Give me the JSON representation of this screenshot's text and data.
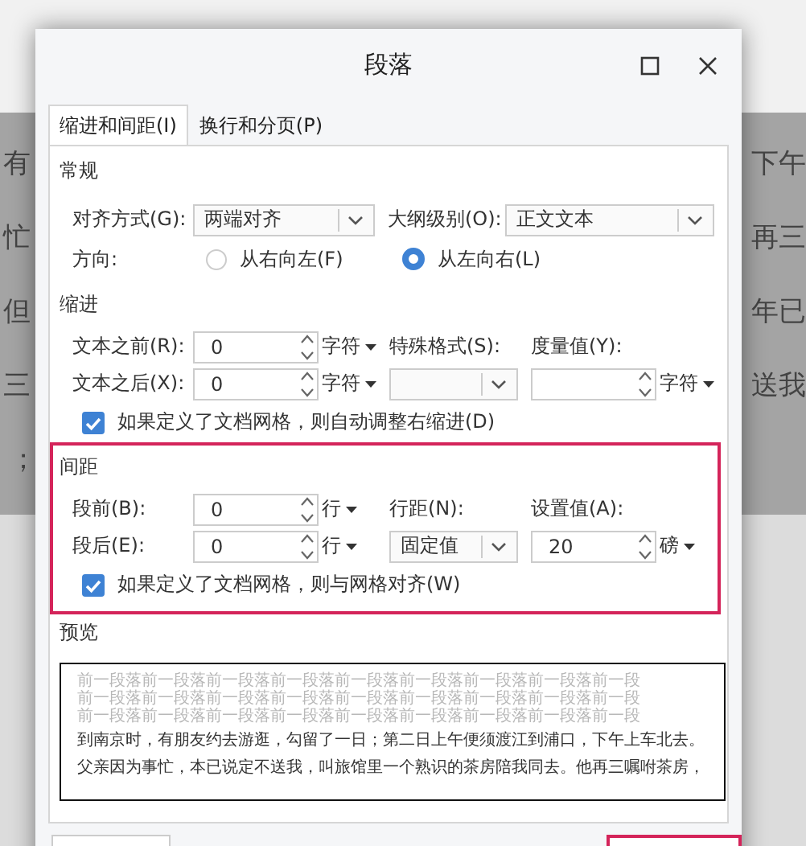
{
  "background_document": {
    "lines": [
      {
        "left": "有",
        "right": "下午"
      },
      {
        "left": "忙",
        "right": "再三"
      },
      {
        "left": "但",
        "right": "年已"
      },
      {
        "left": "三",
        "right": "送我"
      },
      {
        "left": "；"
      }
    ]
  },
  "window": {
    "title": "段落"
  },
  "tabs": [
    {
      "label": "缩进和间距(I)",
      "selected": true
    },
    {
      "label": "换行和分页(P)",
      "selected": false
    }
  ],
  "sections": [
    {
      "heading": "常规",
      "highlighted": false,
      "rows": [
        [
          {
            "kind": "label",
            "text": "对齐方式(G):"
          },
          {
            "kind": "select",
            "value": "两端对齐"
          },
          {
            "kind": "label",
            "text": "大纲级别(O):"
          },
          {
            "kind": "select",
            "value": "正文文本"
          }
        ],
        [
          {
            "kind": "label",
            "text": "方向:"
          },
          {
            "kind": "radio",
            "label": "从右向左(F)",
            "selected": false
          },
          {
            "kind": "radio",
            "label": "从左向右(L)",
            "selected": true
          }
        ]
      ]
    },
    {
      "heading": "缩进",
      "highlighted": false,
      "rows": [
        [
          {
            "kind": "label",
            "text": "文本之前(R):"
          },
          {
            "kind": "spin",
            "value": "0"
          },
          {
            "kind": "unit",
            "text": "字符"
          },
          {
            "kind": "label",
            "text": "特殊格式(S):"
          },
          {
            "kind": "label",
            "text": "度量值(Y):"
          }
        ],
        [
          {
            "kind": "label",
            "text": "文本之后(X):"
          },
          {
            "kind": "spin",
            "value": "0"
          },
          {
            "kind": "unit",
            "text": "字符"
          },
          {
            "kind": "select"
          },
          {
            "kind": "spin"
          },
          {
            "kind": "unit",
            "text": "字符"
          }
        ],
        [
          {
            "kind": "checkbox",
            "label": "如果定义了文档网格，则自动调整右缩进(D)",
            "checked": true
          }
        ]
      ]
    },
    {
      "heading": "间距",
      "highlighted": true,
      "rows": [
        [
          {
            "kind": "label",
            "text": "段前(B):"
          },
          {
            "kind": "spin",
            "value": "0"
          },
          {
            "kind": "unit",
            "text": "行"
          },
          {
            "kind": "label",
            "text": "行距(N):"
          },
          {
            "kind": "label",
            "text": "设置值(A):"
          }
        ],
        [
          {
            "kind": "label",
            "text": "段后(E):"
          },
          {
            "kind": "spin",
            "value": "0"
          },
          {
            "kind": "unit",
            "text": "行"
          },
          {
            "kind": "select",
            "value": "固定值"
          },
          {
            "kind": "spin",
            "value": "20"
          },
          {
            "kind": "unit",
            "text": "磅"
          }
        ],
        [
          {
            "kind": "checkbox",
            "label": "如果定义了文档网格，则与网格对齐(W)",
            "checked": true
          }
        ]
      ]
    }
  ],
  "preview": {
    "heading": "预览",
    "lines": [
      {
        "kind": "previous",
        "text": "前一段落前一段落前一段落前一段落前一段落前一段落前一段落前一段落前一段"
      },
      {
        "kind": "previous",
        "text": "前一段落前一段落前一段落前一段落前一段落前一段落前一段落前一段落前一段"
      },
      {
        "kind": "previous",
        "text": "前一段落前一段落前一段落前一段落前一段落前一段落前一段落前一段落前一段"
      },
      {
        "kind": "current",
        "text": "到南京时，有朋友约去游逛，勾留了一日；第二日上午便须渡江到浦口，下午上车北去。"
      },
      {
        "kind": "current",
        "text": "父亲因为事忙，本已说定不送我，叫旅馆里一个熟识的茶房陪我同去。他再三嘱咐茶房，"
      }
    ]
  },
  "buttons": [
    {
      "highlighted": false
    },
    {
      "highlighted": true
    }
  ]
}
